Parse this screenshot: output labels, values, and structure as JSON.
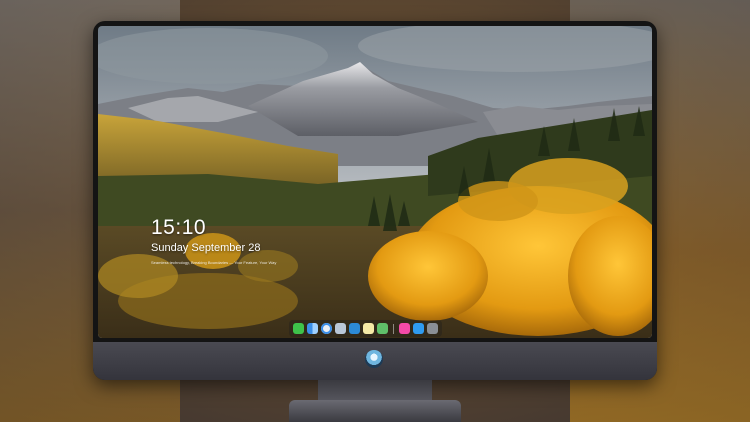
{
  "desktop": {
    "clock": {
      "time": "15:10",
      "date": "Sunday September 28",
      "tagline": "Seamless technology, Breaking Boundaries — Your Feature, Your Way"
    }
  },
  "dock": {
    "items": [
      {
        "name": "messages-icon",
        "color": "#3ec24a"
      },
      {
        "name": "finder-icon",
        "color": "#3a8ee8"
      },
      {
        "name": "safari-icon",
        "color": "#e9eef5"
      },
      {
        "name": "preview-icon",
        "color": "#b9c7d8"
      },
      {
        "name": "clapper-icon",
        "color": "#2c8ad6"
      },
      {
        "name": "notes-icon",
        "color": "#f4e9a6"
      },
      {
        "name": "maps-icon",
        "color": "#5fbf6a"
      },
      {
        "name": "music-icon",
        "color": "#f44aa8"
      },
      {
        "name": "app-store-icon",
        "color": "#2f9bf0"
      },
      {
        "name": "camera-icon",
        "color": "#8a8f96"
      }
    ]
  }
}
